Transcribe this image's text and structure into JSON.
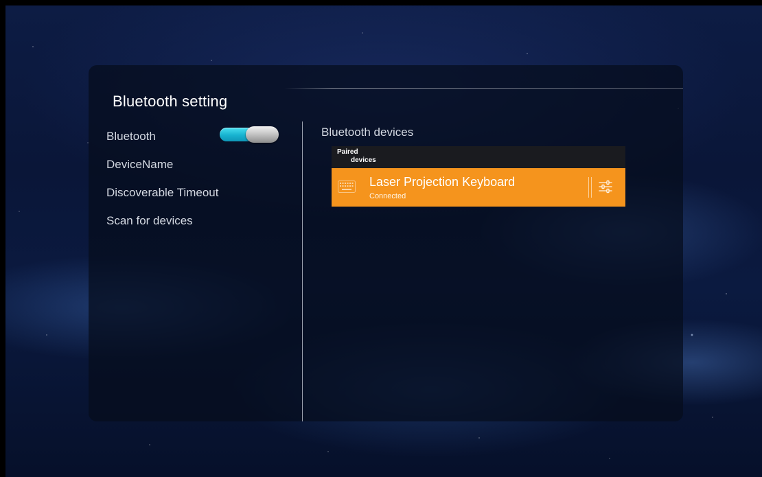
{
  "panel": {
    "title": "Bluetooth setting"
  },
  "menu": {
    "items": [
      {
        "label": "Bluetooth"
      },
      {
        "label": "DeviceName"
      },
      {
        "label": "Discoverable Timeout"
      },
      {
        "label": "Scan for devices"
      }
    ],
    "bluetooth_toggle_state": "on"
  },
  "devices": {
    "title": "Bluetooth devices",
    "paired_header_line1": "Paired",
    "paired_header_line2": "devices",
    "list": [
      {
        "name": "Laser Projection Keyboard",
        "status": "Connected",
        "icon": "keyboard-icon"
      }
    ]
  },
  "colors": {
    "highlight_row": "#f5941d",
    "toggle_on": "#18b3d0"
  }
}
